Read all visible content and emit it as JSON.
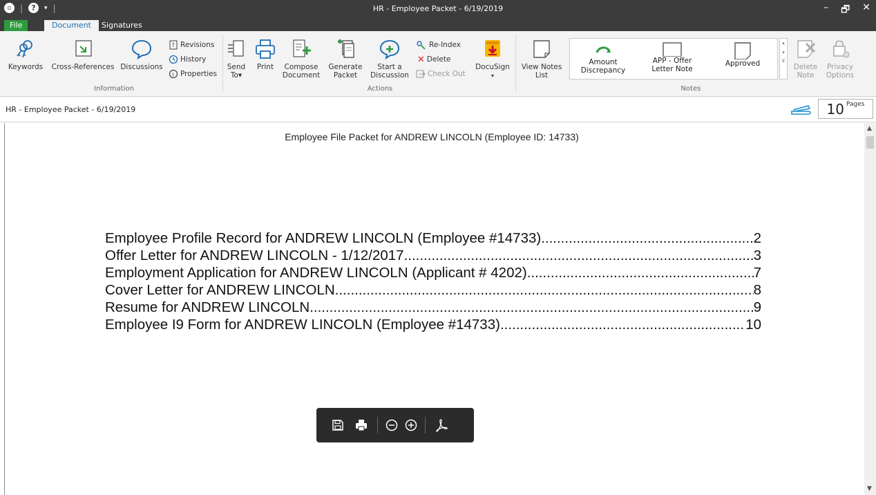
{
  "window": {
    "title": "HR - Employee Packet - 6/19/2019",
    "minimize_icon": "minimize-icon",
    "restore_icon": "restore-icon",
    "close_icon": "close-icon"
  },
  "tabs": {
    "file": "File",
    "document": "Document",
    "signatures": "Signatures"
  },
  "ribbon": {
    "information": {
      "label": "Information",
      "keywords": "Keywords",
      "cross_references": "Cross-References",
      "discussions": "Discussions",
      "revisions": "Revisions",
      "history": "History",
      "properties": "Properties"
    },
    "actions": {
      "label": "Actions",
      "send_to_1": "Send",
      "send_to_2": "To",
      "print": "Print",
      "compose_1": "Compose",
      "compose_2": "Document",
      "generate_1": "Generate",
      "generate_2": "Packet",
      "start_1": "Start a",
      "start_2": "Discussion",
      "reindex": "Re-Index",
      "delete": "Delete",
      "checkout": "Check Out",
      "docusign": "DocuSign"
    },
    "notes": {
      "label": "Notes",
      "view_notes_1": "View Notes",
      "view_notes_2": "List",
      "note1_1": "Amount",
      "note1_2": "Discrepancy",
      "note2_1": "APP - Offer",
      "note2_2": "Letter Note",
      "note3": "Approved",
      "delete_note_1": "Delete",
      "delete_note_2": "Note",
      "privacy_1": "Privacy",
      "privacy_2": "Options"
    }
  },
  "docbar": {
    "title": "HR - Employee Packet - 6/19/2019",
    "page_count": "10",
    "pages_label": "Pages"
  },
  "document": {
    "header": "Employee File Packet for ANDREW LINCOLN (Employee ID: 14733)",
    "toc": [
      {
        "title": "Employee Profile Record for ANDREW LINCOLN (Employee #14733)",
        "page": "2"
      },
      {
        "title": "Offer Letter for ANDREW LINCOLN - 1/12/2017",
        "page": "3"
      },
      {
        "title": "Employment Application for ANDREW LINCOLN (Applicant # 4202)",
        "page": "7"
      },
      {
        "title": "Cover Letter for ANDREW LINCOLN",
        "page": "8"
      },
      {
        "title": "Resume for ANDREW LINCOLN",
        "page": "9"
      },
      {
        "title": "Employee I9 Form for ANDREW LINCOLN (Employee #14733)",
        "page": "10"
      }
    ]
  },
  "colors": {
    "titlebar": "#3c3c3c",
    "file_tab": "#2c9c3e",
    "accent_blue": "#1f6db5",
    "docusign_orange": "#f5a623"
  }
}
